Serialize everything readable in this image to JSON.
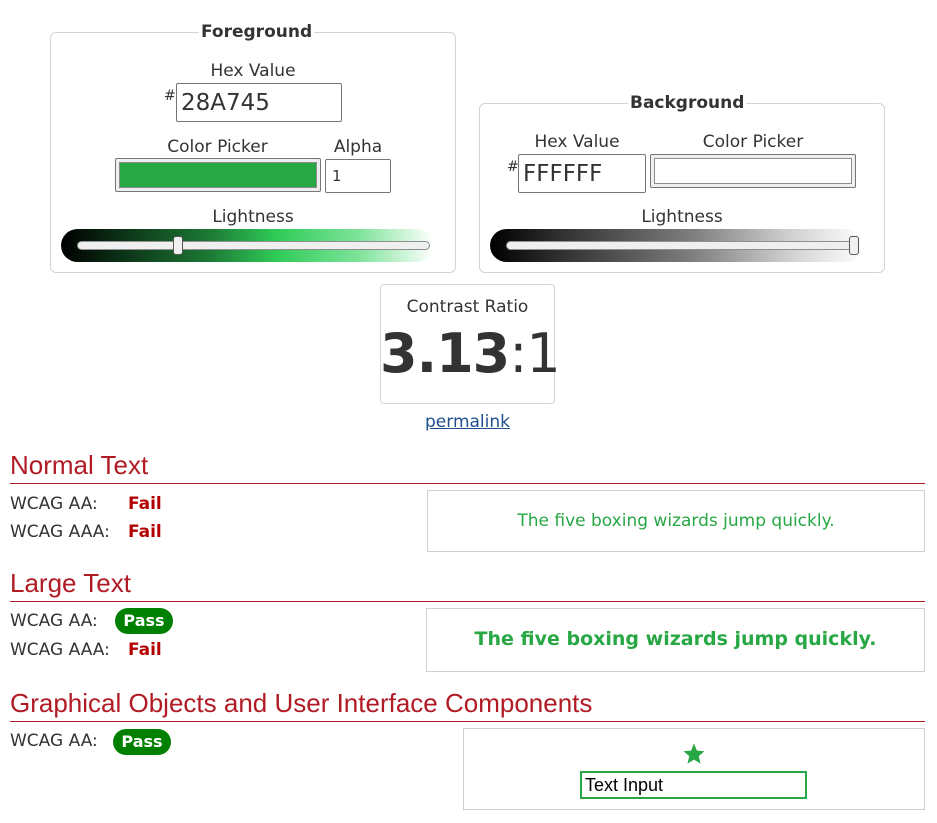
{
  "foreground": {
    "legend": "Foreground",
    "hex_label": "Hex Value",
    "hash": "#",
    "hex_value": "28A745",
    "picker_label": "Color Picker",
    "alpha_label": "Alpha",
    "alpha_value": "1",
    "lightness_label": "Lightness",
    "color": "#28a745",
    "lightness_fraction": 0.28
  },
  "background": {
    "legend": "Background",
    "hex_label": "Hex Value",
    "hash": "#",
    "hex_value": "FFFFFF",
    "picker_label": "Color Picker",
    "lightness_label": "Lightness",
    "color": "#ffffff",
    "lightness_fraction": 1.0
  },
  "contrast": {
    "label": "Contrast Ratio",
    "ratio_bold": "3.13",
    "ratio_rest": ":1",
    "permalink": "permalink"
  },
  "sections": {
    "normal": {
      "title": "Normal Text",
      "aa_label": "WCAG AA:",
      "aa_result": "Fail",
      "aaa_label": "WCAG AAA:",
      "aaa_result": "Fail",
      "sample": "The five boxing wizards jump quickly."
    },
    "large": {
      "title": "Large Text",
      "aa_label": "WCAG AA:",
      "aa_result": "Pass",
      "aaa_label": "WCAG AAA:",
      "aaa_result": "Fail",
      "sample": "The five boxing wizards jump quickly."
    },
    "graphical": {
      "title": "Graphical Objects and User Interface Components",
      "aa_label": "WCAG AA:",
      "aa_result": "Pass",
      "star_icon": "star-icon",
      "input_value": "Text Input"
    }
  },
  "colors": {
    "accent_red": "#b11b24",
    "pass_green": "#008000",
    "fail_red": "#b30000",
    "link": "#1f4e8c"
  }
}
